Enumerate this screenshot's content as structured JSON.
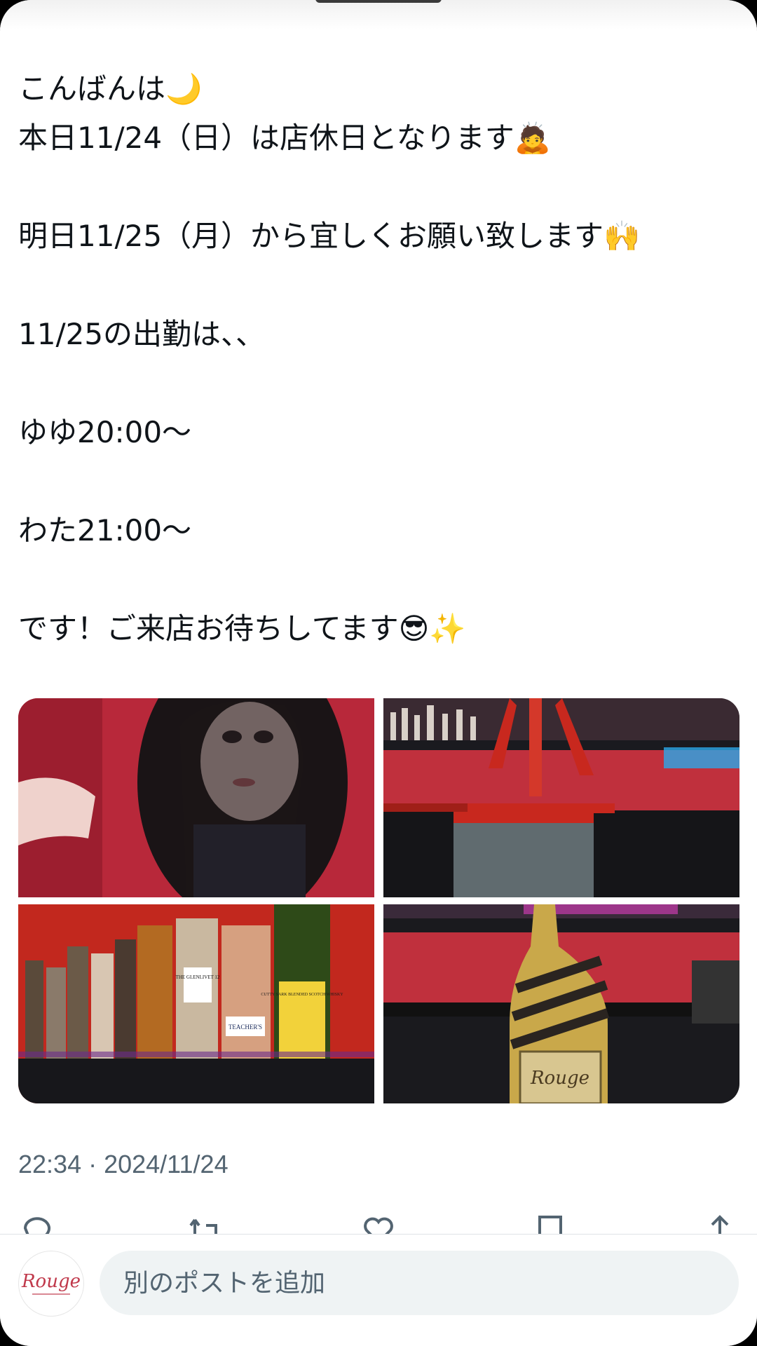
{
  "post": {
    "lines": [
      "こんばんは🌙",
      "本日11/24（日）は店休日となります🙇",
      "",
      "明日11/25（月）から宜しくお願い致します🙌",
      "",
      "11/25の出勤は、、",
      "",
      "ゆゆ20:00〜",
      "",
      "わた21:00〜",
      "",
      "です！ご来店お待ちしてます😎✨"
    ],
    "timestamp": "22:34 · 2024/11/24"
  },
  "media": {
    "tiles": [
      "selfie-photo",
      "bar-counter-photo",
      "whisky-shelf-photo",
      "champagne-bottle-photo"
    ],
    "bottle_labels": [
      "THE GLENLIVET 12",
      "TEACHER'S",
      "CUTTY SARK BLENDED SCOTCH WHISKY"
    ],
    "champagne_label": "Rouge"
  },
  "actions": [
    "reply-icon",
    "repost-icon",
    "like-icon",
    "bookmark-icon",
    "share-icon"
  ],
  "reply_bar": {
    "avatar_text": "Rouge",
    "placeholder": "別のポストを追加"
  },
  "colors": {
    "text": "#0f1419",
    "secondary": "#536471",
    "input_bg": "#eff3f4",
    "accent_red": "#c0394b"
  }
}
